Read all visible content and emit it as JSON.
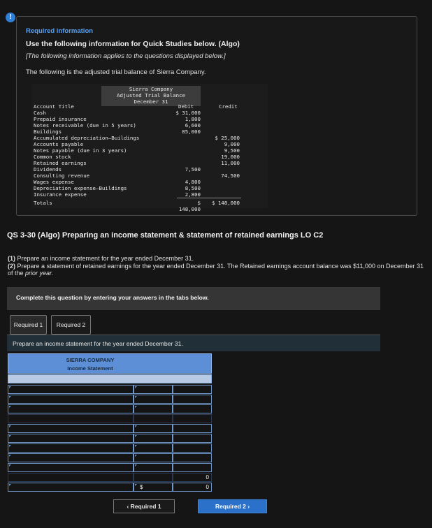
{
  "alert": {
    "icon": "exclamation-icon",
    "glyph": "!"
  },
  "required_info": {
    "title": "Required information",
    "use_line": "Use the following information for Quick Studies below. (Algo)",
    "applies_line": "[The following information applies to the questions displayed below.]",
    "intro": "The following is the adjusted trial balance of Sierra Company."
  },
  "trial_balance": {
    "company": "Sierra Company",
    "title": "Adjusted Trial Balance",
    "date": "December 31",
    "col_account": "Account Title",
    "col_debit": "Debit",
    "col_credit": "Credit",
    "rows": [
      {
        "account": "Cash",
        "debit": "$ 31,000",
        "credit": ""
      },
      {
        "account": "Prepaid insurance",
        "debit": "1,800",
        "credit": ""
      },
      {
        "account": "Notes receivable (due in 5 years)",
        "debit": "6,600",
        "credit": ""
      },
      {
        "account": "Buildings",
        "debit": "85,000",
        "credit": ""
      },
      {
        "account": "Accumulated depreciation—Buildings",
        "debit": "",
        "credit": "$ 25,000"
      },
      {
        "account": "Accounts payable",
        "debit": "",
        "credit": "9,000"
      },
      {
        "account": "Notes payable (due in 3 years)",
        "debit": "",
        "credit": "9,500"
      },
      {
        "account": "Common stock",
        "debit": "",
        "credit": "19,000"
      },
      {
        "account": "Retained earnings",
        "debit": "",
        "credit": "11,000"
      },
      {
        "account": "Dividends",
        "debit": "7,500",
        "credit": ""
      },
      {
        "account": "Consulting revenue",
        "debit": "",
        "credit": "74,500"
      },
      {
        "account": "Wages expense",
        "debit": "4,800",
        "credit": ""
      },
      {
        "account": "Depreciation expense—Buildings",
        "debit": "8,500",
        "credit": ""
      },
      {
        "account": "Insurance expense",
        "debit": "2,800",
        "credit": ""
      }
    ],
    "totals": {
      "label": "Totals",
      "debit": "$ 148,000",
      "credit": "$ 148,000"
    }
  },
  "question": {
    "title": "QS 3-30 (Algo) Preparing an income statement & statement of retained earnings LO C2",
    "p1_num": "(1)",
    "p1": " Prepare an income statement for the year ended December 31.",
    "p2_num": "(2)",
    "p2_a": " Prepare a statement of retained earnings for the year ended December 31. The Retained earnings account balance was $11,000 on December 31 of the ",
    "p2_b": "prior year."
  },
  "instruction": "Complete this question by entering your answers in the tabs below.",
  "tabs": [
    "Required 1",
    "Required 2"
  ],
  "prepare_text": "Prepare an income statement for the year ended December 31.",
  "statement": {
    "company": "SIERRA COMPANY",
    "title": "Income Statement",
    "row_a_value": "0",
    "dollar_sign": "$",
    "row_b_value": "0"
  },
  "nav": {
    "prev": "‹  Required 1",
    "next": "Required 2  ›"
  }
}
